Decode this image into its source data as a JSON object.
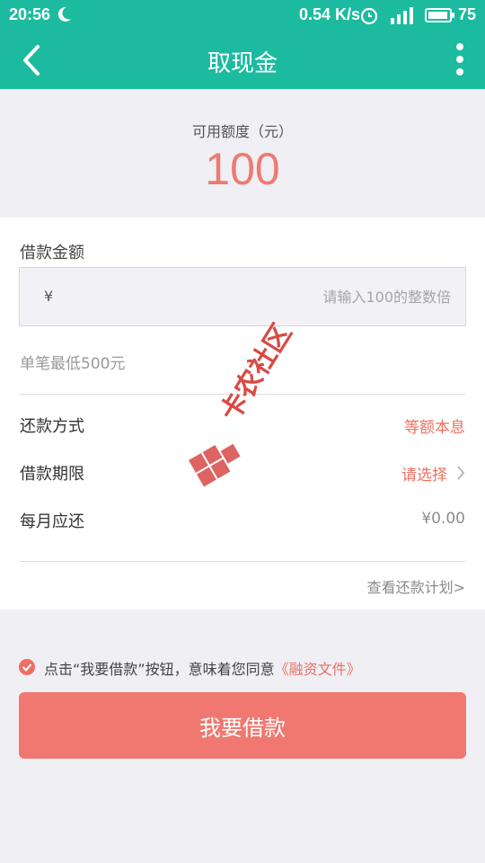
{
  "status_bar": {
    "time": "20:56",
    "net_speed": "0.54 K/s",
    "battery": "75",
    "icons": [
      "moon-icon",
      "alarm-icon",
      "signal-icon",
      "battery-icon"
    ]
  },
  "header": {
    "title": "取现金",
    "back_icon": "chevron-left-icon",
    "more_icon": "more-vertical-icon",
    "color": "#1cbb9f"
  },
  "balance": {
    "label": "可用额度（元）",
    "value": "100",
    "color": "#ee7a70"
  },
  "loan_form": {
    "amount_label": "借款金额",
    "currency_symbol": "¥",
    "amount_placeholder": "请输入100的整数倍",
    "amount_value": "",
    "min_note": "单笔最低500元",
    "repay_method_label": "还款方式",
    "repay_method_value": "等额本息",
    "term_label": "借款期限",
    "term_value": "请选择",
    "monthly_label": "每月应还",
    "monthly_value": "¥0.00",
    "plan_link": "查看还款计划>"
  },
  "agreement": {
    "text": "点击“我要借款”按钮，意味着您同意",
    "link": "《融资文件》",
    "checked": true
  },
  "submit": {
    "label": "我要借款",
    "color": "#f07870"
  },
  "watermark": {
    "text": "卡农社区"
  }
}
